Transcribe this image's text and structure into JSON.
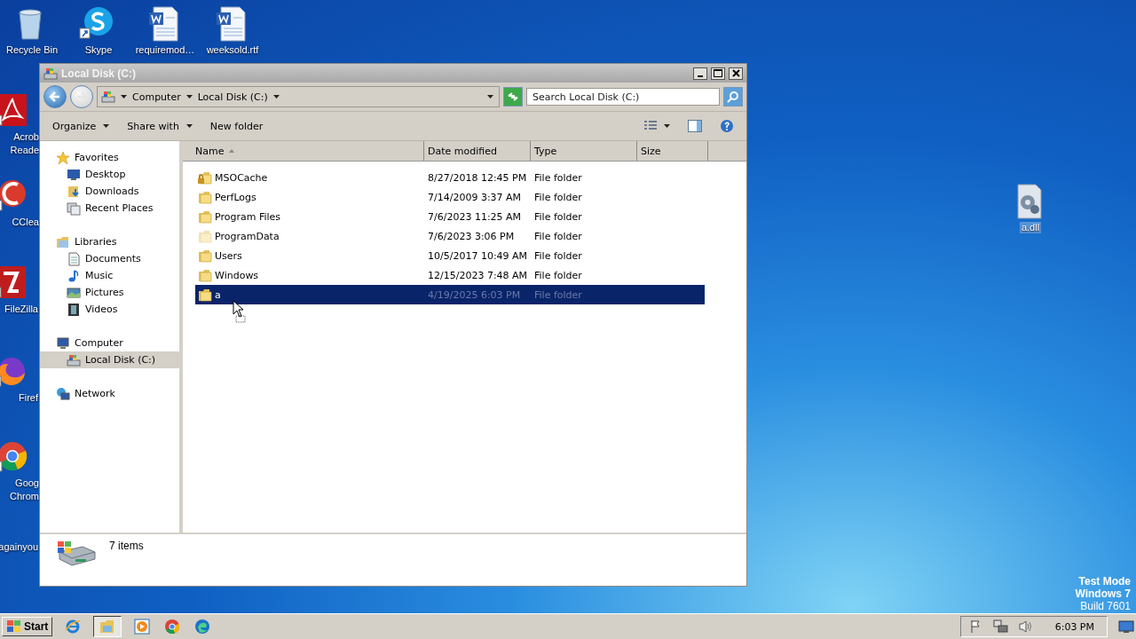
{
  "desktop_icons": [
    {
      "label": "Recycle Bin",
      "kind": "recycle",
      "shortcut": false
    },
    {
      "label": "Skype",
      "kind": "skype",
      "shortcut": true
    },
    {
      "label": "requiremod…",
      "kind": "word",
      "shortcut": false
    },
    {
      "label": "weeksold.rtf",
      "kind": "word",
      "shortcut": false
    },
    {
      "label": "Acrob",
      "label_2": "Reade",
      "kind": "acrobat",
      "shortcut": true
    },
    {
      "label": "CClea",
      "kind": "ccleaner",
      "shortcut": true
    },
    {
      "label": "FileZilla",
      "kind": "filezilla",
      "shortcut": true
    },
    {
      "label": "Firef",
      "kind": "firefox",
      "shortcut": true
    },
    {
      "label": "Goog",
      "label_2": "Chrom",
      "kind": "chrome",
      "shortcut": true
    },
    {
      "label": "againyou",
      "kind": "none"
    },
    {
      "label": "a.dll",
      "kind": "dll",
      "shortcut": false,
      "selected": true
    }
  ],
  "window": {
    "title": "Local Disk (C:)",
    "breadcrumb": [
      "Computer",
      "Local Disk (C:)"
    ],
    "search": {
      "placeholder": "Search Local Disk (C:)"
    },
    "commands": [
      {
        "label": "Organize",
        "dropdown": true
      },
      {
        "label": "Share with",
        "dropdown": true
      },
      {
        "label": "New folder",
        "dropdown": false
      }
    ],
    "nav": [
      {
        "label": "Favorites",
        "kind": "star",
        "selected": false,
        "children": [
          {
            "label": "Desktop",
            "kind": "desktop",
            "selected": false
          },
          {
            "label": "Downloads",
            "kind": "downloads",
            "selected": false
          },
          {
            "label": "Recent Places",
            "kind": "recent",
            "selected": false
          }
        ]
      },
      {
        "label": "Libraries",
        "kind": "library",
        "selected": false,
        "children": [
          {
            "label": "Documents",
            "kind": "documents",
            "selected": false
          },
          {
            "label": "Music",
            "kind": "music",
            "selected": false
          },
          {
            "label": "Pictures",
            "kind": "pictures",
            "selected": false
          },
          {
            "label": "Videos",
            "kind": "videos",
            "selected": false
          }
        ]
      },
      {
        "label": "Computer",
        "kind": "computer",
        "selected": false,
        "children": [
          {
            "label": "Local Disk (C:)",
            "kind": "drive",
            "selected": true
          }
        ]
      },
      {
        "label": "Network",
        "kind": "network",
        "selected": false
      }
    ],
    "columns": [
      {
        "label": "Name",
        "sorted": true
      },
      {
        "label": "Date modified",
        "sorted": false
      },
      {
        "label": "Type",
        "sorted": false
      },
      {
        "label": "Size",
        "sorted": false
      }
    ],
    "rows": [
      {
        "name": "MSOCache",
        "date": "8/27/2018 12:45 PM",
        "type": "File folder",
        "locked": true,
        "hidden": false,
        "selected": false
      },
      {
        "name": "PerfLogs",
        "date": "7/14/2009 3:37 AM",
        "type": "File folder",
        "locked": false,
        "hidden": false,
        "selected": false
      },
      {
        "name": "Program Files",
        "date": "7/6/2023 11:25 AM",
        "type": "File folder",
        "locked": false,
        "hidden": false,
        "selected": false
      },
      {
        "name": "ProgramData",
        "date": "7/6/2023 3:06 PM",
        "type": "File folder",
        "locked": false,
        "hidden": true,
        "selected": false
      },
      {
        "name": "Users",
        "date": "10/5/2017 10:49 AM",
        "type": "File folder",
        "locked": false,
        "hidden": false,
        "selected": false
      },
      {
        "name": "Windows",
        "date": "12/15/2023 7:48 AM",
        "type": "File folder",
        "locked": false,
        "hidden": false,
        "selected": false
      },
      {
        "name": "a",
        "date": "4/19/2025 6:03 PM",
        "type": "File folder",
        "locked": false,
        "hidden": false,
        "selected": true
      }
    ],
    "status": "7 items"
  },
  "watermark_lines": [
    "Test Mode",
    "Windows 7",
    "Build 7601"
  ],
  "taskbar": {
    "start": "Start",
    "apps": [
      {
        "kind": "ie",
        "selected": false
      },
      {
        "kind": "explorer",
        "selected": true
      },
      {
        "kind": "player",
        "selected": false
      },
      {
        "kind": "chrome",
        "selected": false
      },
      {
        "kind": "edge",
        "selected": false
      }
    ],
    "clock": "6:03 PM"
  }
}
